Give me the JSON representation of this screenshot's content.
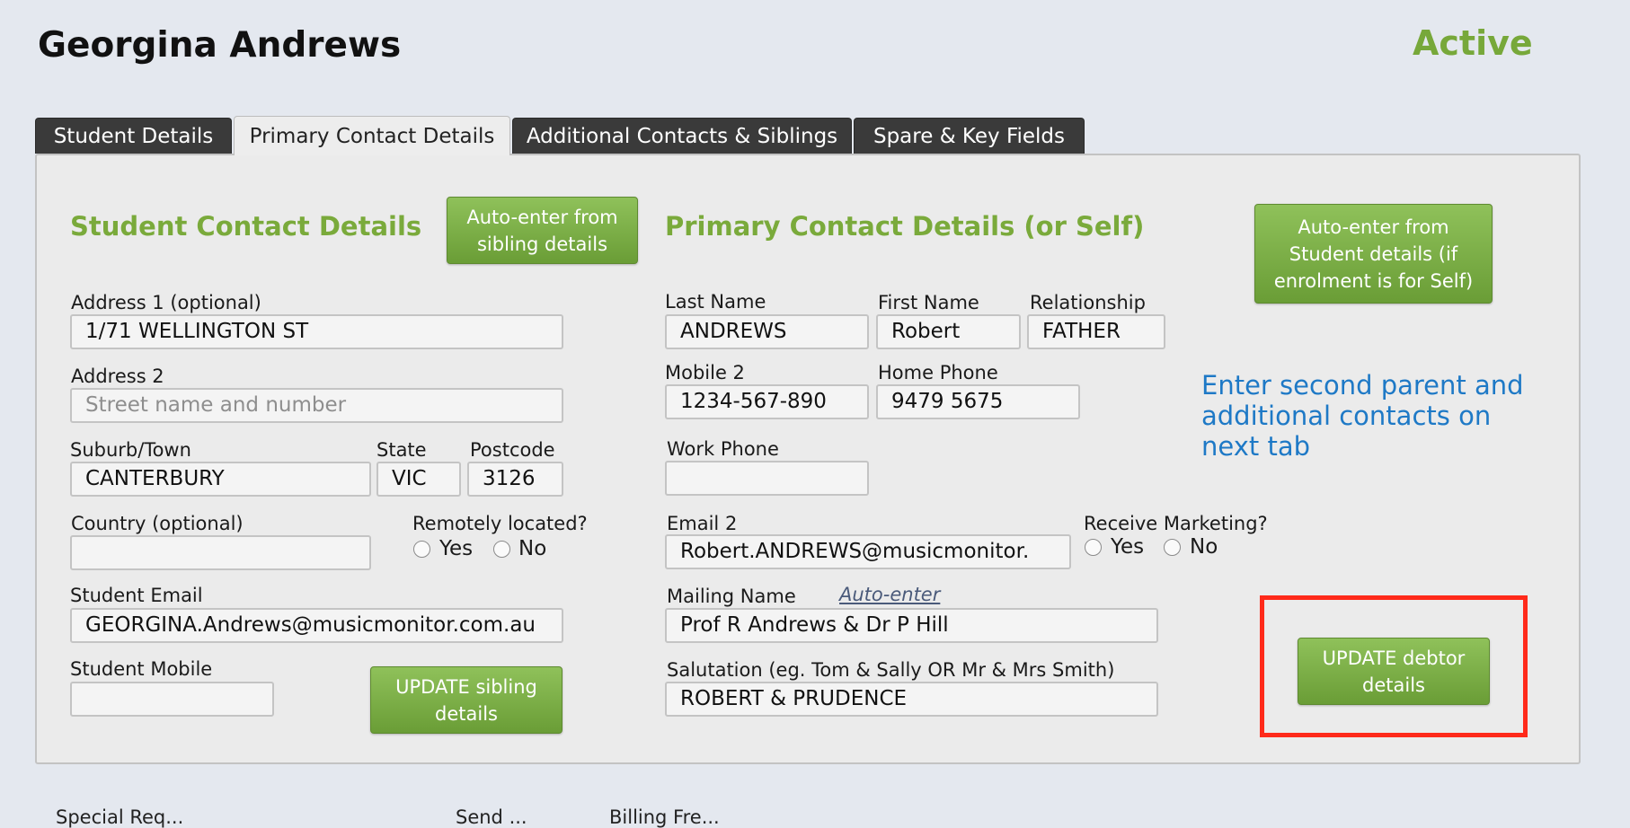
{
  "header": {
    "student_name": "Georgina Andrews",
    "status": "Active"
  },
  "tabs": [
    {
      "label": "Student Details",
      "active": false
    },
    {
      "label": "Primary Contact Details",
      "active": true
    },
    {
      "label": "Additional Contacts & Siblings",
      "active": false
    },
    {
      "label": "Spare & Key Fields",
      "active": false
    }
  ],
  "student_contact": {
    "title": "Student Contact Details",
    "auto_enter_sibling_label": "Auto-enter from sibling details",
    "address1_label": "Address 1 (optional)",
    "address1_value": "1/71 WELLINGTON ST",
    "address2_label": "Address 2",
    "address2_placeholder": "Street name and number",
    "suburb_label": "Suburb/Town",
    "suburb_value": "CANTERBURY",
    "state_label": "State",
    "state_value": "VIC",
    "postcode_label": "Postcode",
    "postcode_value": "3126",
    "country_label": "Country (optional)",
    "country_value": "",
    "remote_label": "Remotely located?",
    "yes_label": "Yes",
    "no_label": "No",
    "email_label": "Student Email",
    "email_value": "GEORGINA.Andrews@musicmonitor.com.au",
    "mobile_label": "Student Mobile",
    "mobile_value": "",
    "update_sibling_label": "UPDATE sibling details"
  },
  "primary_contact": {
    "title": "Primary Contact Details (or Self)",
    "auto_enter_student_label": "Auto-enter from Student details (if enrolment is for Self)",
    "last_name_label": "Last Name",
    "last_name_value": "ANDREWS",
    "first_name_label": "First Name",
    "first_name_value": "Robert",
    "relationship_label": "Relationship",
    "relationship_value": "FATHER",
    "mobile2_label": "Mobile 2",
    "mobile2_value": "1234-567-890",
    "home_phone_label": "Home Phone",
    "home_phone_value": "9479 5675",
    "work_phone_label": "Work Phone",
    "work_phone_value": "",
    "email2_label": "Email 2",
    "email2_value": "Robert.ANDREWS@musicmonitor.",
    "marketing_label": "Receive Marketing?",
    "yes_label": "Yes",
    "no_label": "No",
    "mailing_name_label": "Mailing Name",
    "auto_enter_link": "Auto-enter",
    "mailing_name_value": "Prof R Andrews & Dr P Hill",
    "salutation_label": "Salutation (eg. Tom & Sally OR Mr & Mrs Smith)",
    "salutation_value": "ROBERT & PRUDENCE",
    "info_text": "Enter second parent and additional contacts on next tab",
    "update_debtor_label": "UPDATE debtor details"
  },
  "colors": {
    "accent_green": "#7aaa3b",
    "info_blue": "#1e79c6",
    "highlight_red": "#ff2a1a"
  },
  "footer": {
    "left_text": "Special Req...",
    "mid_text": "Send ...",
    "right_text": "Billing Fre..."
  }
}
